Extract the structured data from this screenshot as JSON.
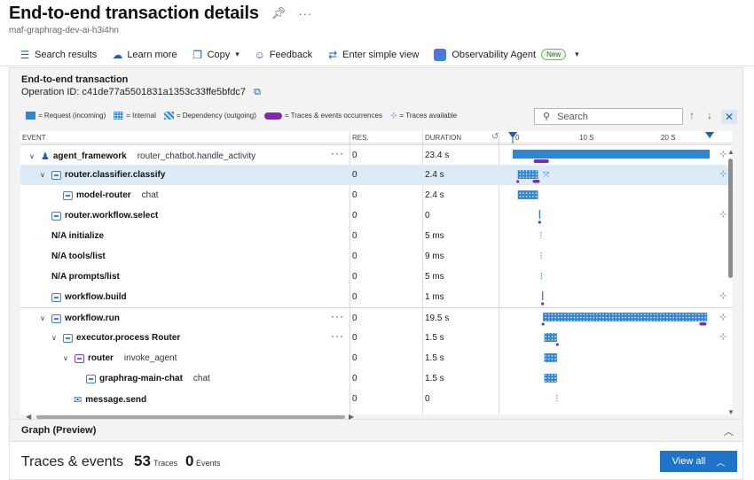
{
  "header": {
    "title": "End-to-end transaction details",
    "subtitle": "maf-graphrag-dev-ai-h3i4hn"
  },
  "toolbar": {
    "search_results": "Search results",
    "learn_more": "Learn more",
    "copy": "Copy",
    "feedback": "Feedback",
    "simple_view": "Enter simple view",
    "observability_agent": "Observability Agent",
    "new_badge": "New"
  },
  "panel": {
    "title": "End-to-end transaction",
    "operation_label": "Operation ID:",
    "operation_id": "c41de77a5501831a1353c33ffe5bfdc7"
  },
  "legend": {
    "request": "= Request (incoming)",
    "internal": "= Internal",
    "dependency": "= Dependency (outgoing)",
    "traces": "= Traces & events occurrences",
    "available": "= Traces available"
  },
  "search": {
    "placeholder": "Search"
  },
  "columns": {
    "event": "EVENT",
    "res": "RES.",
    "duration": "DURATION"
  },
  "timeline_axis": {
    "t0": "0",
    "t1": "10 S",
    "t2": "20 S",
    "max_seconds": 23.4
  },
  "rows": [
    {
      "name": "agent_framework",
      "op": "router_chatbot.handle_activity",
      "res": "0",
      "duration": "23.4 s"
    },
    {
      "name": "router.classifier.classify",
      "op": "",
      "res": "0",
      "duration": "2.4 s"
    },
    {
      "name": "model-router",
      "op": "chat",
      "res": "0",
      "duration": "2.4 s"
    },
    {
      "name": "router.workflow.select",
      "op": "",
      "res": "0",
      "duration": "0"
    },
    {
      "name": "N/A initialize",
      "op": "",
      "res": "0",
      "duration": "5 ms"
    },
    {
      "name": "N/A tools/list",
      "op": "",
      "res": "0",
      "duration": "9 ms"
    },
    {
      "name": "N/A prompts/list",
      "op": "",
      "res": "0",
      "duration": "5 ms"
    },
    {
      "name": "workflow.build",
      "op": "",
      "res": "0",
      "duration": "1 ms"
    },
    {
      "name": "workflow.run",
      "op": "",
      "res": "0",
      "duration": "19.5 s"
    },
    {
      "name": "executor.process Router",
      "op": "",
      "res": "0",
      "duration": "1.5 s"
    },
    {
      "name": "router",
      "op": "invoke_agent",
      "res": "0",
      "duration": "1.5 s"
    },
    {
      "name": "graphrag-main-chat",
      "op": "chat",
      "res": "0",
      "duration": "1.5 s"
    },
    {
      "name": "message.send",
      "op": "",
      "res": "0",
      "duration": "0"
    }
  ],
  "spans": [
    {
      "start": 0.0,
      "dur": 23.4,
      "kind": "request",
      "traces": [
        2.5,
        4.3
      ]
    },
    {
      "start": 0.6,
      "dur": 2.4,
      "kind": "internal",
      "traces": [
        0.6,
        2.9
      ]
    },
    {
      "start": 0.6,
      "dur": 2.4,
      "kind": "internal",
      "traces": []
    },
    {
      "start": 3.2,
      "dur": 0.0,
      "kind": "marker",
      "traces": [
        3.2
      ]
    },
    {
      "start": 3.35,
      "dur": 0.0,
      "kind": "tick",
      "traces": []
    },
    {
      "start": 3.38,
      "dur": 0.0,
      "kind": "tick",
      "traces": []
    },
    {
      "start": 3.42,
      "dur": 0.0,
      "kind": "tick",
      "traces": []
    },
    {
      "start": 3.55,
      "dur": 0.0,
      "kind": "marker",
      "traces": [
        3.55
      ]
    },
    {
      "start": 3.6,
      "dur": 19.5,
      "kind": "internal",
      "traces": [
        3.6,
        22.7
      ]
    },
    {
      "start": 3.75,
      "dur": 1.5,
      "kind": "internal",
      "traces": [
        5.3
      ]
    },
    {
      "start": 3.75,
      "dur": 1.5,
      "kind": "internal",
      "traces": []
    },
    {
      "start": 3.75,
      "dur": 1.5,
      "kind": "internal",
      "traces": []
    },
    {
      "start": 5.25,
      "dur": 0.0,
      "kind": "tick",
      "traces": []
    }
  ],
  "graph": {
    "title": "Graph (Preview)"
  },
  "footer": {
    "title": "Traces & events",
    "traces_count": "53",
    "traces_label": "Traces",
    "events_count": "0",
    "events_label": "Events",
    "view_all": "View all"
  },
  "colors": {
    "accent": "#1f73c8",
    "span": "#2f86d3",
    "trace": "#7f2ab0"
  }
}
